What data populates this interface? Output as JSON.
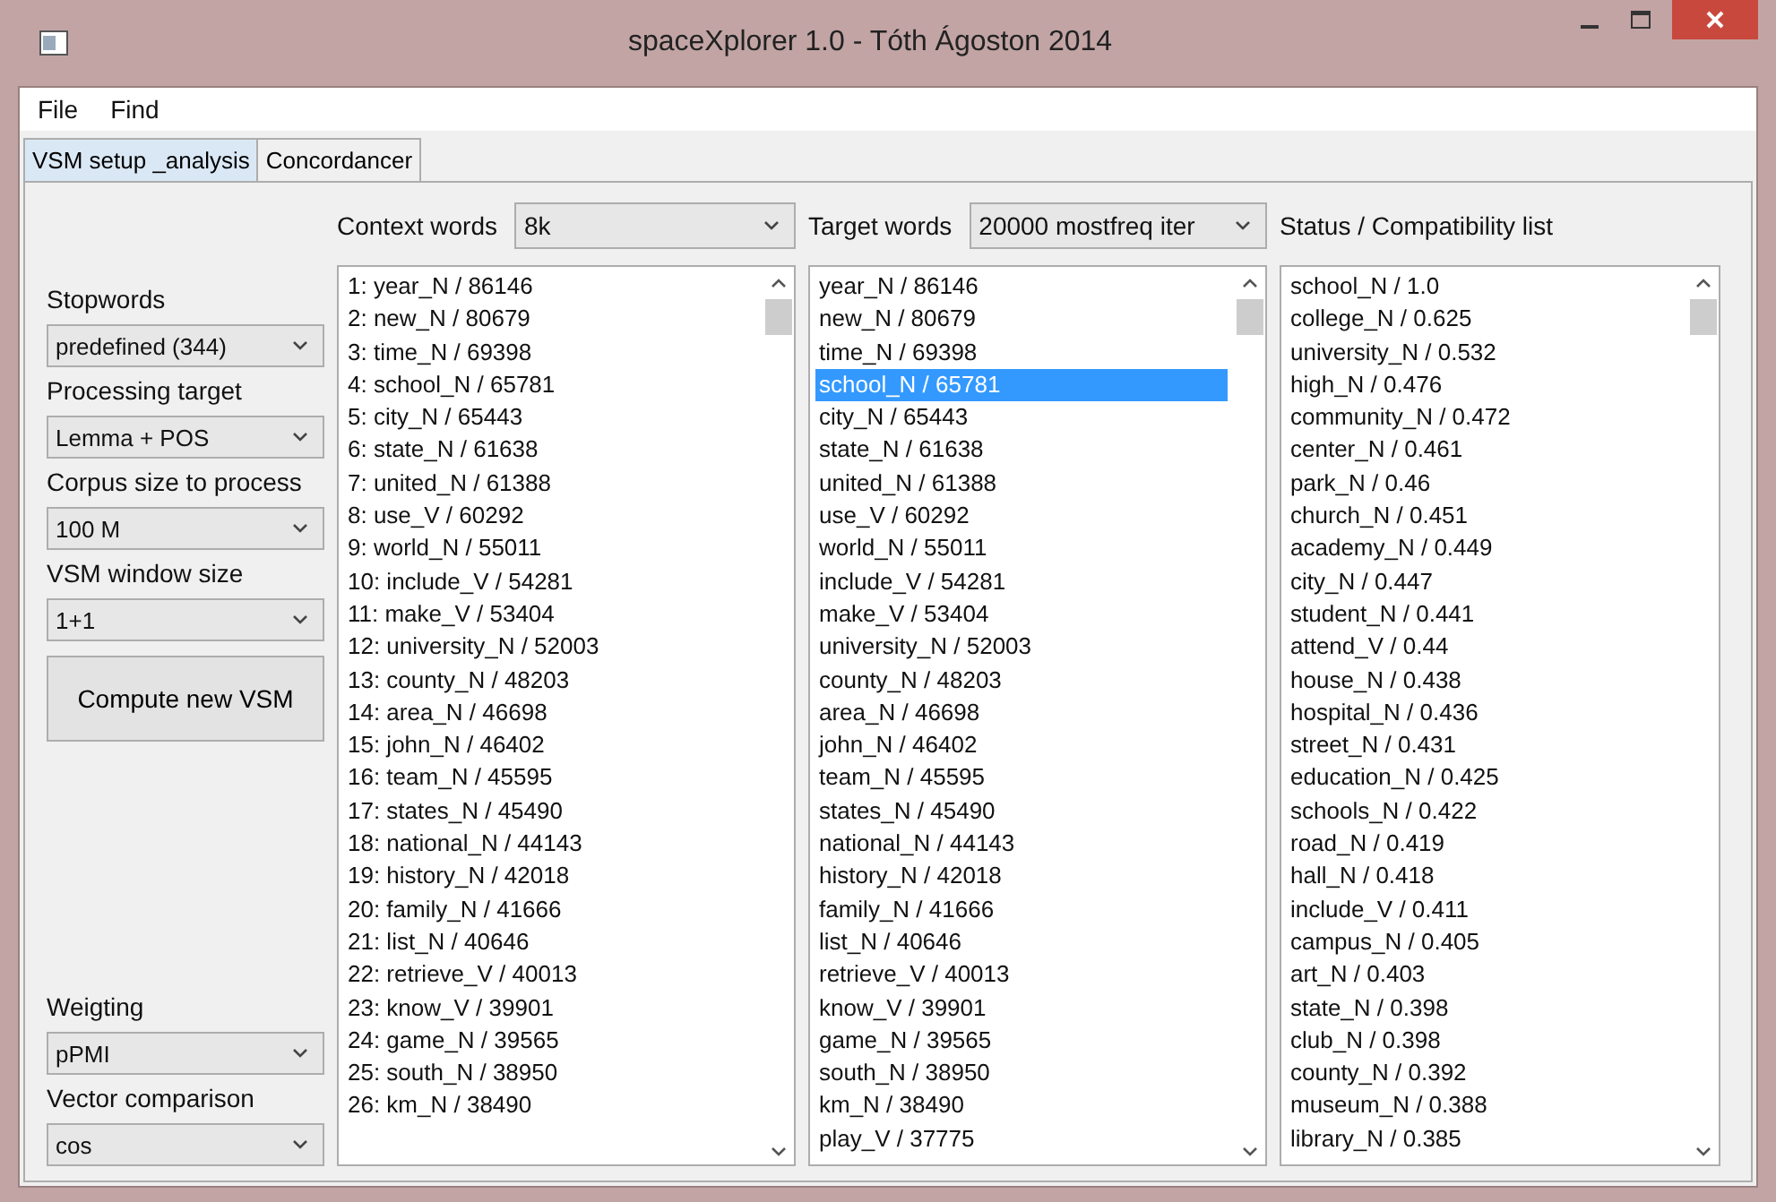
{
  "window": {
    "title": "spaceXplorer 1.0 - Tóth Ágoston 2014"
  },
  "menu": [
    "File",
    "Find"
  ],
  "tabs": [
    {
      "label": "VSM setup _analysis",
      "selected": true
    },
    {
      "label": "Concordancer",
      "selected": false
    }
  ],
  "settings": [
    {
      "label": "Stopwords",
      "value": "predefined (344)"
    },
    {
      "label": "Processing target",
      "value": "Lemma + POS"
    },
    {
      "label": "Corpus size to process",
      "value": "100 M"
    },
    {
      "label": "VSM window size",
      "value": "1+1"
    }
  ],
  "compute_button": "Compute new VSM",
  "comparison_settings": [
    {
      "label": "Weigting",
      "value": "pPMI"
    },
    {
      "label": "Vector comparison",
      "value": "cos"
    }
  ],
  "lists": [
    {
      "label": "Context words",
      "dropdown": "8k",
      "items": [
        {
          "text": "1: year_N / 86146",
          "selected": false
        },
        {
          "text": "2: new_N / 80679",
          "selected": false
        },
        {
          "text": "3: time_N / 69398",
          "selected": false
        },
        {
          "text": "4: school_N / 65781",
          "selected": false
        },
        {
          "text": "5: city_N / 65443",
          "selected": false
        },
        {
          "text": "6: state_N / 61638",
          "selected": false
        },
        {
          "text": "7: united_N / 61388",
          "selected": false
        },
        {
          "text": "8: use_V / 60292",
          "selected": false
        },
        {
          "text": "9: world_N / 55011",
          "selected": false
        },
        {
          "text": "10: include_V / 54281",
          "selected": false
        },
        {
          "text": "11: make_V / 53404",
          "selected": false
        },
        {
          "text": "12: university_N / 52003",
          "selected": false
        },
        {
          "text": "13: county_N / 48203",
          "selected": false
        },
        {
          "text": "14: area_N / 46698",
          "selected": false
        },
        {
          "text": "15: john_N / 46402",
          "selected": false
        },
        {
          "text": "16: team_N / 45595",
          "selected": false
        },
        {
          "text": "17: states_N / 45490",
          "selected": false
        },
        {
          "text": "18: national_N / 44143",
          "selected": false
        },
        {
          "text": "19: history_N / 42018",
          "selected": false
        },
        {
          "text": "20: family_N / 41666",
          "selected": false
        },
        {
          "text": "21: list_N / 40646",
          "selected": false
        },
        {
          "text": "22: retrieve_V / 40013",
          "selected": false
        },
        {
          "text": "23: know_V / 39901",
          "selected": false
        },
        {
          "text": "24: game_N / 39565",
          "selected": false
        },
        {
          "text": "25: south_N / 38950",
          "selected": false
        },
        {
          "text": "26: km_N / 38490",
          "selected": false
        }
      ]
    },
    {
      "label": "Target words",
      "dropdown": "20000 mostfreq iter",
      "items": [
        {
          "text": "year_N / 86146",
          "selected": false
        },
        {
          "text": "new_N / 80679",
          "selected": false
        },
        {
          "text": "time_N / 69398",
          "selected": false
        },
        {
          "text": "school_N / 65781",
          "selected": true
        },
        {
          "text": "city_N / 65443",
          "selected": false
        },
        {
          "text": "state_N / 61638",
          "selected": false
        },
        {
          "text": "united_N / 61388",
          "selected": false
        },
        {
          "text": "use_V / 60292",
          "selected": false
        },
        {
          "text": "world_N / 55011",
          "selected": false
        },
        {
          "text": "include_V / 54281",
          "selected": false
        },
        {
          "text": "make_V / 53404",
          "selected": false
        },
        {
          "text": "university_N / 52003",
          "selected": false
        },
        {
          "text": "county_N / 48203",
          "selected": false
        },
        {
          "text": "area_N / 46698",
          "selected": false
        },
        {
          "text": "john_N / 46402",
          "selected": false
        },
        {
          "text": "team_N / 45595",
          "selected": false
        },
        {
          "text": "states_N / 45490",
          "selected": false
        },
        {
          "text": "national_N / 44143",
          "selected": false
        },
        {
          "text": "history_N / 42018",
          "selected": false
        },
        {
          "text": "family_N / 41666",
          "selected": false
        },
        {
          "text": "list_N / 40646",
          "selected": false
        },
        {
          "text": "retrieve_V / 40013",
          "selected": false
        },
        {
          "text": "know_V / 39901",
          "selected": false
        },
        {
          "text": "game_N / 39565",
          "selected": false
        },
        {
          "text": "south_N / 38950",
          "selected": false
        },
        {
          "text": "km_N / 38490",
          "selected": false
        },
        {
          "text": "play_V / 37775",
          "selected": false
        }
      ]
    },
    {
      "label": "Status / Compatibility list",
      "items": [
        {
          "text": "school_N / 1.0",
          "selected": false
        },
        {
          "text": "college_N / 0.625",
          "selected": false
        },
        {
          "text": "university_N / 0.532",
          "selected": false
        },
        {
          "text": "high_N / 0.476",
          "selected": false
        },
        {
          "text": "community_N / 0.472",
          "selected": false
        },
        {
          "text": "center_N / 0.461",
          "selected": false
        },
        {
          "text": "park_N / 0.46",
          "selected": false
        },
        {
          "text": "church_N / 0.451",
          "selected": false
        },
        {
          "text": "academy_N / 0.449",
          "selected": false
        },
        {
          "text": "city_N / 0.447",
          "selected": false
        },
        {
          "text": "student_N / 0.441",
          "selected": false
        },
        {
          "text": "attend_V / 0.44",
          "selected": false
        },
        {
          "text": "house_N / 0.438",
          "selected": false
        },
        {
          "text": "hospital_N / 0.436",
          "selected": false
        },
        {
          "text": "street_N / 0.431",
          "selected": false
        },
        {
          "text": "education_N / 0.425",
          "selected": false
        },
        {
          "text": "schools_N / 0.422",
          "selected": false
        },
        {
          "text": "road_N / 0.419",
          "selected": false
        },
        {
          "text": "hall_N / 0.418",
          "selected": false
        },
        {
          "text": "include_V / 0.411",
          "selected": false
        },
        {
          "text": "campus_N / 0.405",
          "selected": false
        },
        {
          "text": "art_N / 0.403",
          "selected": false
        },
        {
          "text": "state_N / 0.398",
          "selected": false
        },
        {
          "text": "club_N / 0.398",
          "selected": false
        },
        {
          "text": "county_N / 0.392",
          "selected": false
        },
        {
          "text": "museum_N / 0.388",
          "selected": false
        },
        {
          "text": "library_N / 0.385",
          "selected": false
        }
      ]
    }
  ]
}
